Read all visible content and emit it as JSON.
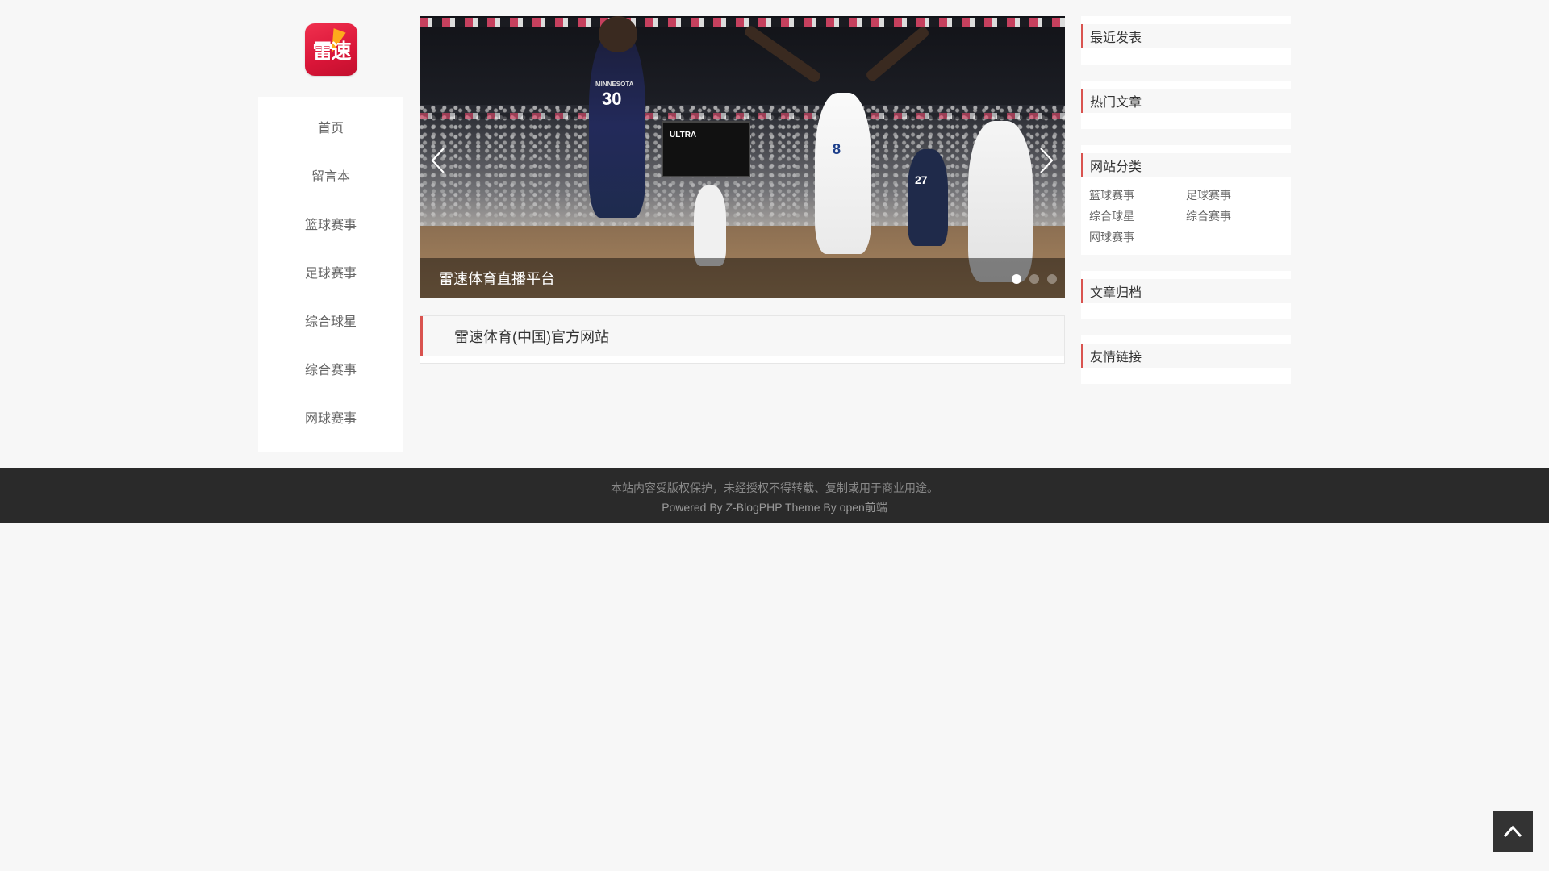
{
  "logo": {
    "text": "雷速"
  },
  "nav": {
    "items": [
      {
        "label": "首页"
      },
      {
        "label": "留言本"
      },
      {
        "label": "篮球赛事"
      },
      {
        "label": "足球赛事"
      },
      {
        "label": "综合球星"
      },
      {
        "label": "综合赛事"
      },
      {
        "label": "网球赛事"
      }
    ]
  },
  "slider": {
    "caption": "雷速体育直播平台",
    "active_dot": 1,
    "dot_count": 3,
    "jersey_1": {
      "team": "MINNESOTA",
      "number": "30"
    },
    "jersey_2": {
      "number": "8"
    },
    "jersey_3": {
      "number": "27"
    },
    "arena_sign": "ULTRA"
  },
  "post": {
    "title": "雷速体育(中国)官方网站"
  },
  "sidebar": {
    "recent_title": "最近发表",
    "hot_title": "热门文章",
    "categories_title": "网站分类",
    "categories": [
      "篮球赛事",
      "足球赛事",
      "综合球星",
      "综合赛事",
      "网球赛事"
    ],
    "archive_title": "文章归档",
    "links_title": "友情链接"
  },
  "footer": {
    "copyright": "本站内容受版权保护，未经授权不得转载、复制或用于商业用途。",
    "powered": "Powered By Z-BlogPHP Theme By open前端"
  },
  "colors": {
    "accent": "#d9534f",
    "page_bg": "#f7f7f7",
    "footer_bg": "#2a2a2a",
    "logo_red": "#e5213f",
    "logo_bolt": "#ffb21a"
  },
  "icons": {
    "prev": "chevron-left-icon",
    "next": "chevron-right-icon",
    "back_to_top": "chevron-up-icon"
  }
}
